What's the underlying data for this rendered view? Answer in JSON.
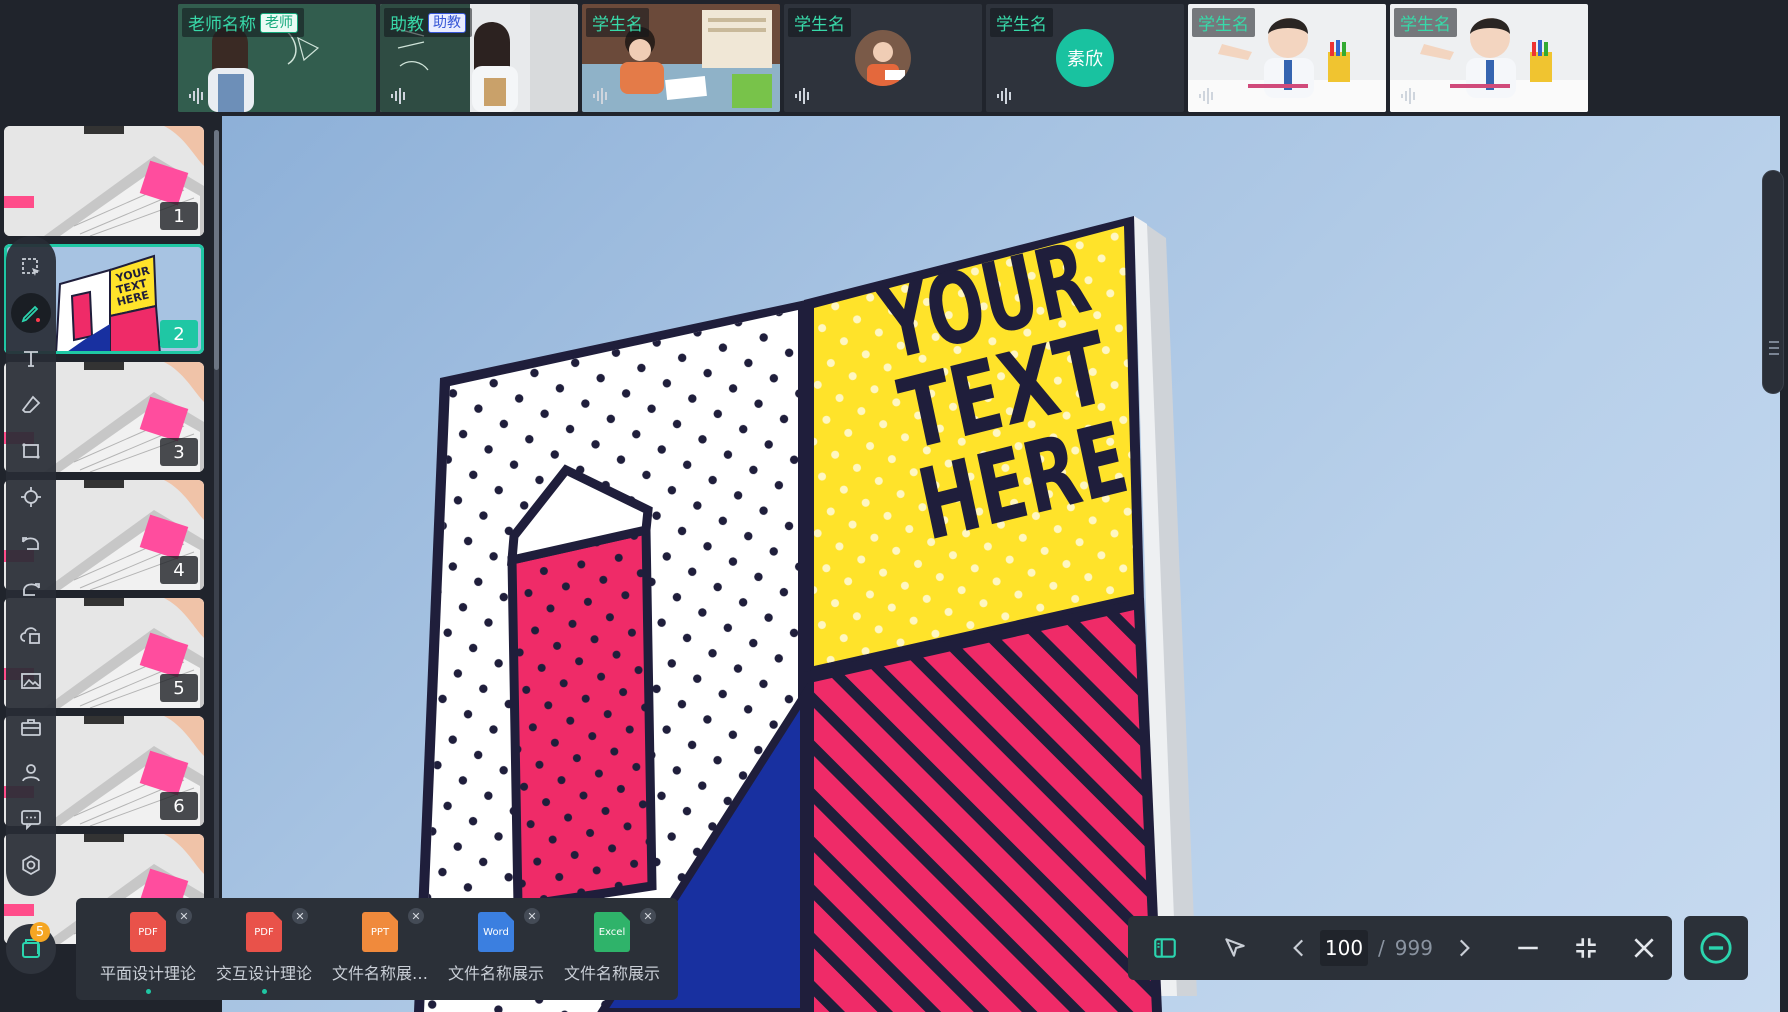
{
  "participants": [
    {
      "name": "老师名称",
      "role": "老师",
      "role_type": "teacher",
      "scene": "teacher-chalkboard"
    },
    {
      "name": "助教",
      "role": "助教",
      "role_type": "assistant",
      "scene": "assistant-chalkboard"
    },
    {
      "name": "学生名",
      "role": "",
      "scene": "student-desk"
    },
    {
      "name": "学生名",
      "role": "",
      "scene": "student-photo-avatar"
    },
    {
      "name": "学生名",
      "role": "",
      "scene": "student-text-avatar",
      "avatar_text": "素欣"
    },
    {
      "name": "学生名",
      "role": "",
      "scene": "student-boy"
    },
    {
      "name": "学生名",
      "role": "",
      "scene": "student-boy"
    }
  ],
  "slide": {
    "billboard_lines": [
      "YOUR",
      "TEXT",
      "HERE"
    ],
    "colors": {
      "sky": "#a7c3e2",
      "yellow": "#ffe32a",
      "pink": "#ef2b68",
      "navy": "#1f1e3b",
      "blue": "#1830a0"
    }
  },
  "thumbnails": [
    {
      "page": "1",
      "active": false
    },
    {
      "page": "2",
      "active": true
    },
    {
      "page": "3",
      "active": false
    },
    {
      "page": "4",
      "active": false
    },
    {
      "page": "5",
      "active": false
    },
    {
      "page": "6",
      "active": false
    },
    {
      "page": "",
      "active": false
    }
  ],
  "tools": [
    {
      "name": "select-tool",
      "icon": "select-icon",
      "active": false
    },
    {
      "name": "pen-tool",
      "icon": "pen-icon",
      "active": true
    },
    {
      "name": "text-tool",
      "icon": "text-icon",
      "active": false
    },
    {
      "name": "eraser-tool",
      "icon": "eraser-icon",
      "active": false
    },
    {
      "name": "shape-tool",
      "icon": "rectangle-icon",
      "active": false
    },
    {
      "name": "laser-tool",
      "icon": "laser-pointer-icon",
      "active": false
    },
    {
      "name": "undo-tool",
      "icon": "undo-icon",
      "active": false
    },
    {
      "name": "redo-tool",
      "icon": "redo-icon",
      "active": false
    },
    {
      "name": "cloud-files-tool",
      "icon": "cloud-file-icon",
      "active": false
    },
    {
      "name": "image-tool",
      "icon": "image-icon",
      "active": false
    },
    {
      "name": "toolbox-tool",
      "icon": "toolbox-icon",
      "active": false
    },
    {
      "name": "user-tool",
      "icon": "user-icon",
      "active": false
    },
    {
      "name": "chat-tool",
      "icon": "chat-icon",
      "active": false
    },
    {
      "name": "settings-tool",
      "icon": "settings-icon",
      "active": false
    }
  ],
  "files_fab": {
    "count": "5"
  },
  "files": [
    {
      "type": "PDF",
      "color": "#e9524a",
      "name": "平面设计理论",
      "active": true
    },
    {
      "type": "PDF",
      "color": "#e9524a",
      "name": "交互设计理论",
      "active": true
    },
    {
      "type": "PPT",
      "color": "#f08a3c",
      "name": "文件名称展…",
      "active": false
    },
    {
      "type": "Word",
      "color": "#3b7fe0",
      "name": "文件名称展示",
      "active": false
    },
    {
      "type": "Excel",
      "color": "#2fb36a",
      "name": "文件名称展示",
      "active": false
    }
  ],
  "pager": {
    "current": "100",
    "separator": "/",
    "total": "999"
  }
}
